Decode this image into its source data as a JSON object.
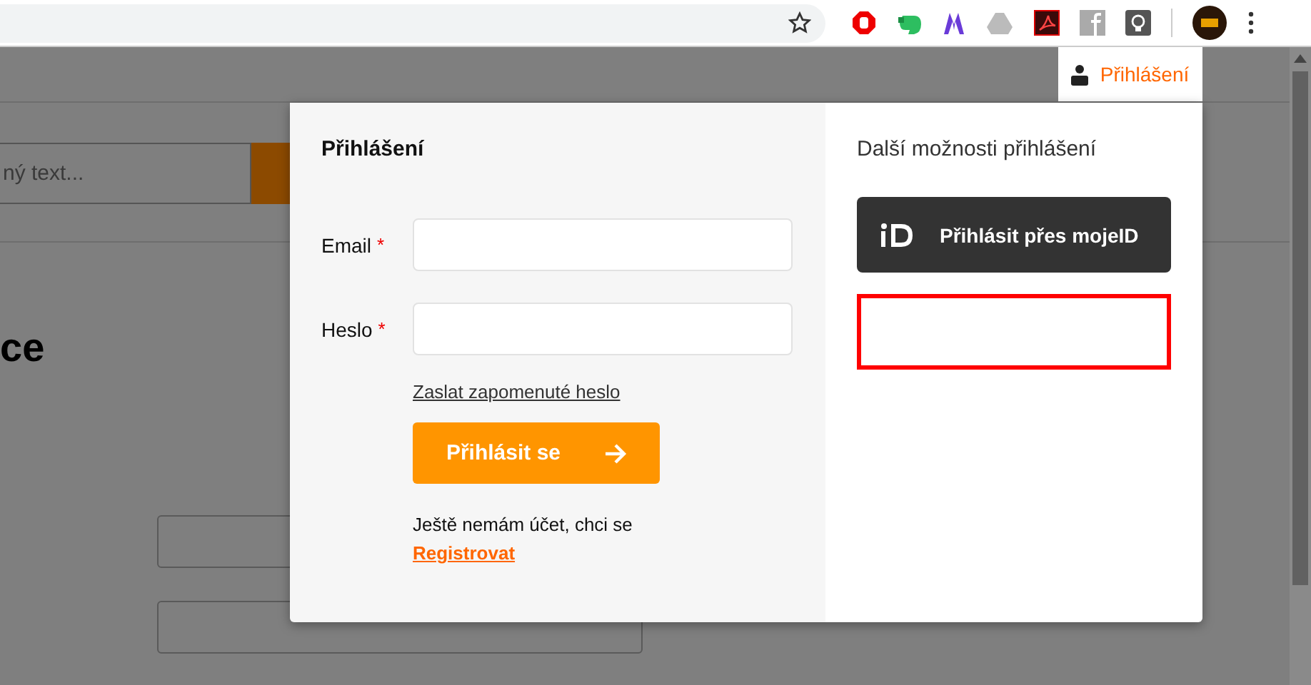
{
  "background_page": {
    "search": {
      "placeholder": "ný text..."
    },
    "heading": "ce"
  },
  "header": {
    "login_tab": "Přihlášení"
  },
  "login_dialog": {
    "title": "Přihlášení",
    "fields": [
      {
        "label": "Email",
        "required_mark": "*"
      },
      {
        "label": "Heslo",
        "required_mark": "*"
      }
    ],
    "forgot_link": "Zaslat zapomenuté heslo",
    "submit_button": "Přihlásit se",
    "register_text": "Ještě nemám účet, chci se",
    "register_link": "Registrovat"
  },
  "other_options": {
    "title": "Další možnosti přihlášení",
    "buttons": [
      {
        "kind": "mojeid",
        "label": "Přihlásit přes mojeID"
      },
      {
        "kind": "outlined"
      }
    ]
  }
}
